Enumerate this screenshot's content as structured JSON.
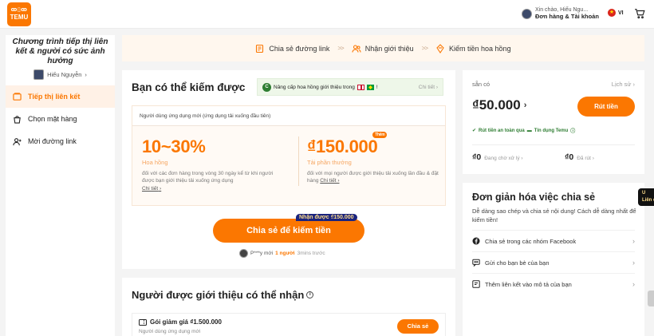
{
  "header": {
    "logo_line1": "ꝏ▯ꝏ",
    "logo_line2": "TEMU",
    "greeting": "Xin chào, Hiếu Ngu...",
    "orders_account": "Đơn hàng & Tài khoản",
    "language": "VI"
  },
  "sidebar": {
    "title": "Chương trình tiếp thị liên kết & người có sức ảnh hưởng",
    "user_name": "Hiếu Nguyễn",
    "items": [
      {
        "label": "Tiếp thị liên kết",
        "active": true
      },
      {
        "label": "Chọn mặt hàng",
        "active": false
      },
      {
        "label": "Mời đường link",
        "active": false
      }
    ]
  },
  "steps": [
    {
      "label": "Chia sẻ đường link",
      "icon": "share-link-icon"
    },
    {
      "label": "Nhận giới thiệu",
      "icon": "users-icon"
    },
    {
      "label": "Kiếm tiền hoa hồng",
      "icon": "commission-icon"
    }
  ],
  "earn": {
    "title": "Bạn có thể kiếm được",
    "promo_text": "Nâng cấp hoa hồng giới thiệu trong",
    "promo_detail": "Chi tiết",
    "box_header": "Người dùng ứng dụng mới (ứng dụng tải xuống đầu tiên)",
    "commission_value": "10~30%",
    "commission_label": "Hoa hồng",
    "commission_desc": "đối với các đơn hàng trong vòng 30 ngày kể từ khi người được bạn giới thiệu tải xuống ứng dụng",
    "commission_link": "Chi tiết",
    "reward_value": "₫150.000",
    "reward_badge": "Thêm",
    "reward_label": "Tải phần thưởng",
    "reward_desc": "đối với mọi người được giới thiệu tải xuống lần đầu & đặt hàng",
    "reward_link": "Chi tiết",
    "share_button": "Chia sẻ để kiếm tiền",
    "bonus_tag": "Nhận được ₫150.000",
    "recent_user": "P***y mới",
    "recent_count": "1 người",
    "recent_time": "3mins trước"
  },
  "referred": {
    "title": "Người được giới thiệu có thể nhận",
    "voucher_title": "Gói giảm giá ₫1.500.000",
    "voucher_sub": "Người dùng ứng dụng mới",
    "voucher_button": "Chia sẻ"
  },
  "wallet": {
    "label": "sẵn có",
    "history": "Lịch sử",
    "amount": "₫50.000",
    "withdraw_button": "Rút tiền",
    "safe_text": "Rút tiền an toàn qua",
    "safe_partner": "Tín dụng Temu",
    "pending_amount": "₫0",
    "pending_label": "Đang chờ xử lý",
    "paid_amount": "₫0",
    "paid_label": "Đã rút"
  },
  "simplify": {
    "title": "Đơn giản hóa việc chia sẻ",
    "desc": "Dễ dàng sao chép và chia sẻ nội dung! Cách dễ dàng nhất để kiếm tiền!",
    "items": [
      {
        "label": "Chia sẻ trong các nhóm Facebook",
        "icon": "facebook-icon"
      },
      {
        "label": "Gửi cho bạn bè của bạn",
        "icon": "chat-icon"
      },
      {
        "label": "Thêm liên kết vào mô tả của bạn",
        "icon": "link-description-icon"
      }
    ]
  },
  "edge_popup": "U\nLiên độ",
  "colors": {
    "accent": "#fb7701",
    "green": "#2e7d32",
    "navy": "#1a237e"
  }
}
